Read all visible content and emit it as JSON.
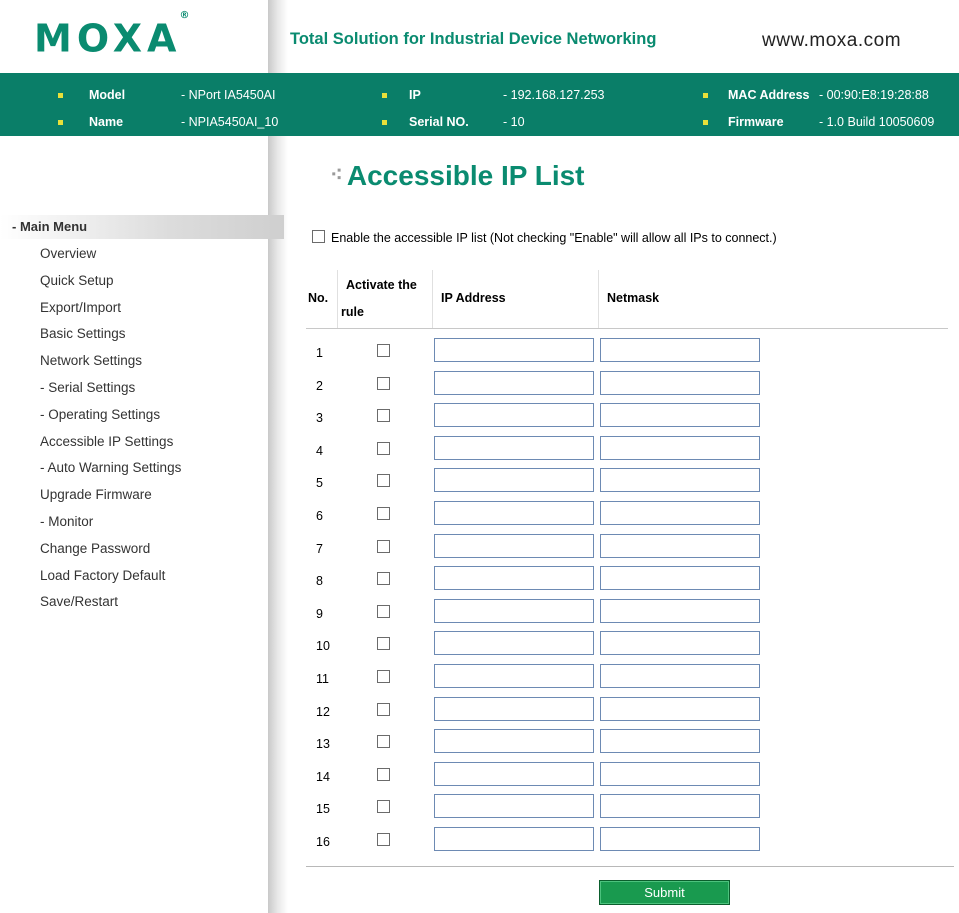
{
  "header": {
    "logo": "MOXA",
    "logo_mark": "®",
    "tagline": "Total Solution for Industrial Device Networking",
    "website": "www.moxa.com"
  },
  "info": {
    "model_label": "Model",
    "model_value": "- NPort IA5450AI",
    "name_label": "Name",
    "name_value": "- NPIA5450AI_10",
    "ip_label": "IP",
    "ip_value": "- 192.168.127.253",
    "serial_label": "Serial NO.",
    "serial_value": "- 10",
    "mac_label": "MAC Address",
    "mac_value": "- 00:90:E8:19:28:88",
    "firmware_label": "Firmware",
    "firmware_value": "- 1.0 Build 10050609"
  },
  "sidebar": {
    "header": "- Main Menu",
    "items": [
      "Overview",
      "Quick Setup",
      "Export/Import",
      "Basic Settings",
      "Network Settings",
      "- Serial Settings",
      "- Operating Settings",
      "Accessible IP Settings",
      "- Auto Warning Settings",
      "Upgrade Firmware",
      "- Monitor",
      "Change Password",
      "Load Factory Default",
      "Save/Restart"
    ]
  },
  "page": {
    "title_dots": "⁖",
    "title": "Accessible IP List",
    "enable_label": "Enable the accessible IP list (Not checking \"Enable\" will allow all IPs to connect.)",
    "enable_checked": false
  },
  "table": {
    "col_no": "No.",
    "col_activate_1": "Activate the",
    "col_activate_2": "rule",
    "col_ip": "IP Address",
    "col_netmask": "Netmask",
    "rows": [
      {
        "no": "1",
        "active": false,
        "ip": "",
        "netmask": ""
      },
      {
        "no": "2",
        "active": false,
        "ip": "",
        "netmask": ""
      },
      {
        "no": "3",
        "active": false,
        "ip": "",
        "netmask": ""
      },
      {
        "no": "4",
        "active": false,
        "ip": "",
        "netmask": ""
      },
      {
        "no": "5",
        "active": false,
        "ip": "",
        "netmask": ""
      },
      {
        "no": "6",
        "active": false,
        "ip": "",
        "netmask": ""
      },
      {
        "no": "7",
        "active": false,
        "ip": "",
        "netmask": ""
      },
      {
        "no": "8",
        "active": false,
        "ip": "",
        "netmask": ""
      },
      {
        "no": "9",
        "active": false,
        "ip": "",
        "netmask": ""
      },
      {
        "no": "10",
        "active": false,
        "ip": "",
        "netmask": ""
      },
      {
        "no": "11",
        "active": false,
        "ip": "",
        "netmask": ""
      },
      {
        "no": "12",
        "active": false,
        "ip": "",
        "netmask": ""
      },
      {
        "no": "13",
        "active": false,
        "ip": "",
        "netmask": ""
      },
      {
        "no": "14",
        "active": false,
        "ip": "",
        "netmask": ""
      },
      {
        "no": "15",
        "active": false,
        "ip": "",
        "netmask": ""
      },
      {
        "no": "16",
        "active": false,
        "ip": "",
        "netmask": ""
      }
    ]
  },
  "buttons": {
    "submit": "Submit"
  },
  "colors": {
    "brand_green": "#0a8b70",
    "infobar_bg": "#0a7e68",
    "bullet": "#e8e03a",
    "submit_bg": "#199a4f"
  }
}
